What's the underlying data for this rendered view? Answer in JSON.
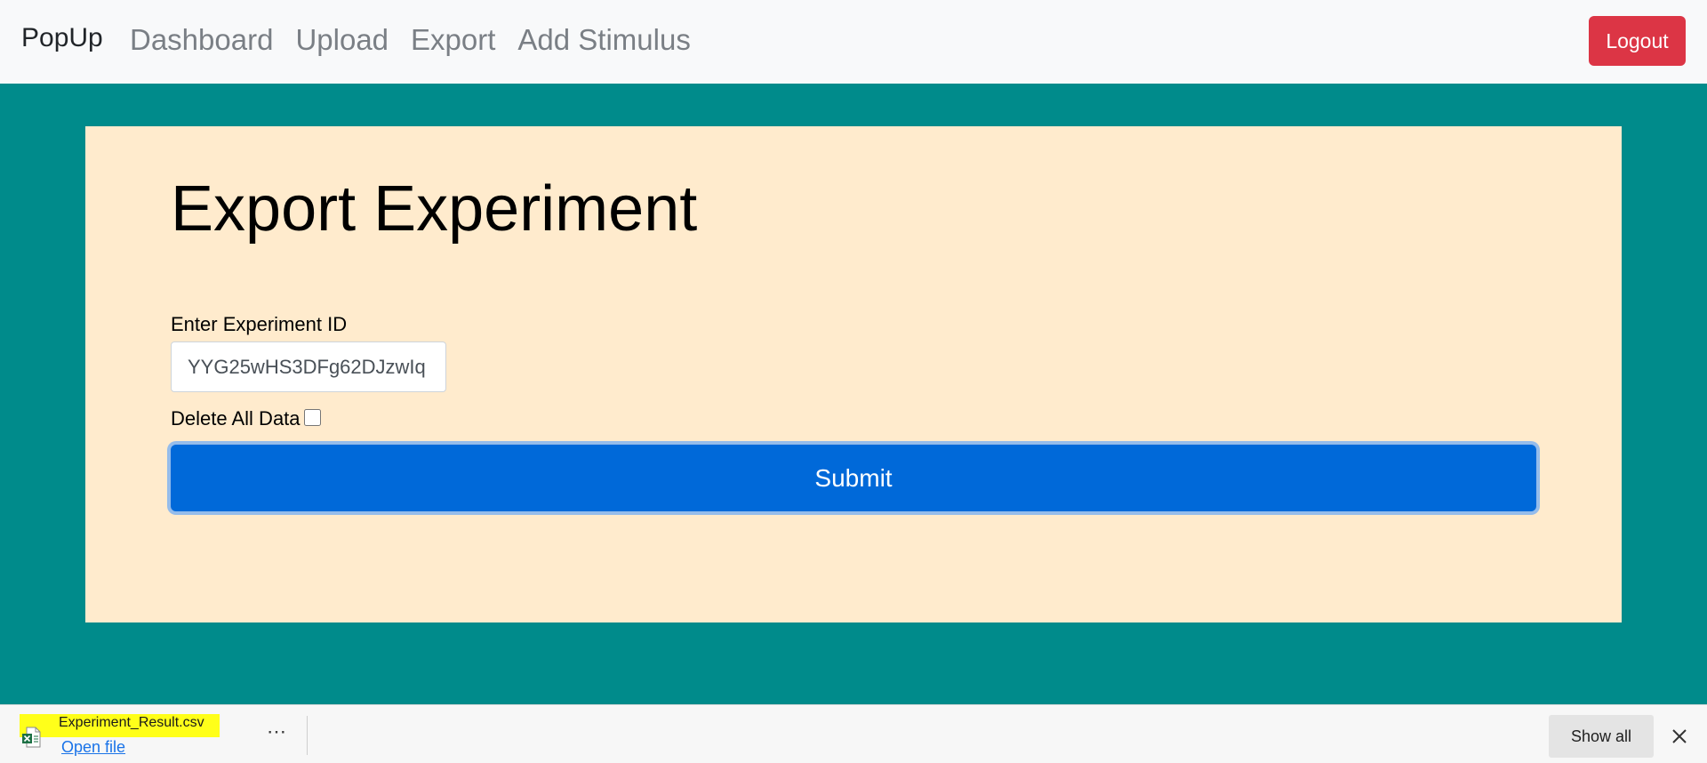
{
  "navbar": {
    "brand": "PopUp",
    "links": [
      "Dashboard",
      "Upload",
      "Export",
      "Add Stimulus"
    ],
    "logout_label": "Logout"
  },
  "main": {
    "title": "Export Experiment",
    "field_label": "Enter Experiment ID",
    "experiment_id_value": "YYG25wHS3DFg62DJzwIq",
    "delete_label": "Delete All Data",
    "delete_checked": false,
    "submit_label": "Submit"
  },
  "download_bar": {
    "file_name": "Experiment_Result.csv",
    "file_icon": "excel-file-icon",
    "open_label": "Open file",
    "more_label": "⋯",
    "show_all_label": "Show all",
    "close_icon": "close-icon"
  },
  "colors": {
    "page_background": "#008b8b",
    "panel_background": "#ffebcd",
    "logout": "#dc3545",
    "submit": "#0069d9",
    "highlight": "#ffff1a"
  }
}
